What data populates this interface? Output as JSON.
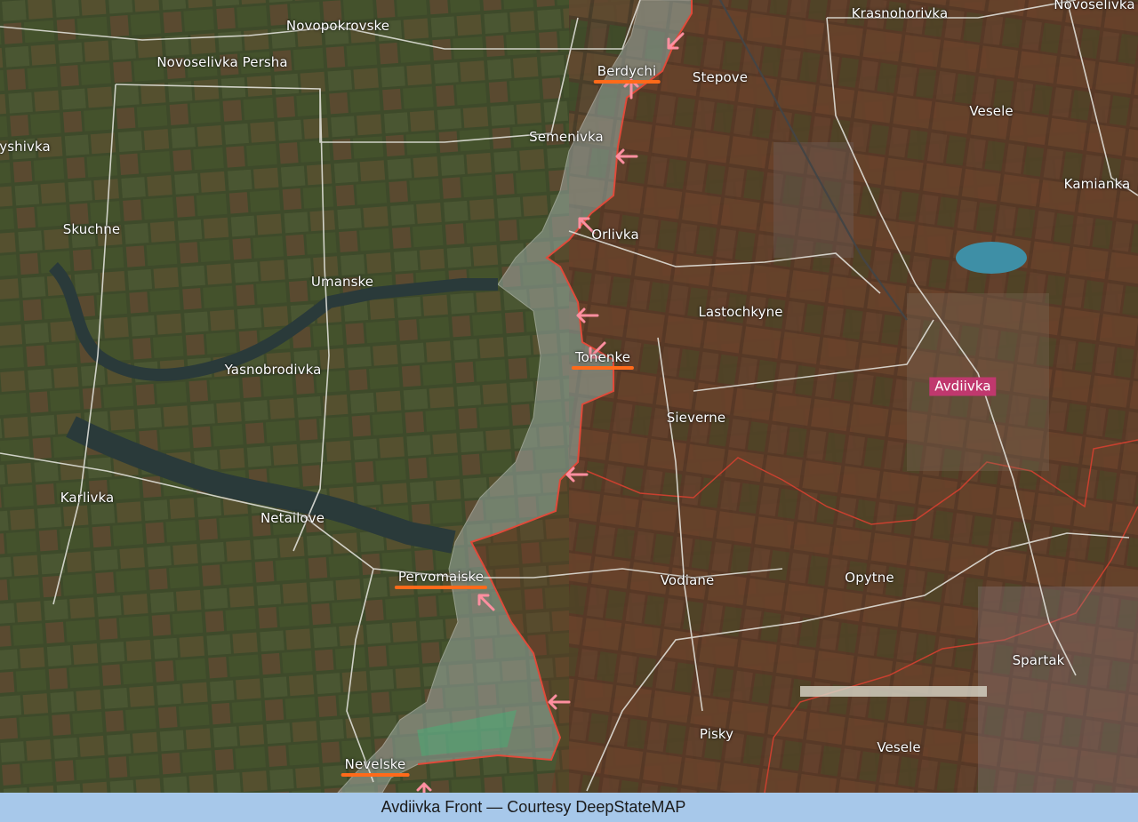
{
  "map": {
    "labels": [
      {
        "id": "novopokrovske",
        "text": "Novopokrovske"
      },
      {
        "id": "novoselivka-persha",
        "text": "Novoselivka Persha"
      },
      {
        "id": "berdychi",
        "text": "Berdychi"
      },
      {
        "id": "stepove",
        "text": "Stepove"
      },
      {
        "id": "krasnohorivka",
        "text": "Krasnohorivka"
      },
      {
        "id": "novoselivka",
        "text": "Novoselivka"
      },
      {
        "id": "vesele-north",
        "text": "Vesele"
      },
      {
        "id": "yshivka",
        "text": "yshivka"
      },
      {
        "id": "semenivka",
        "text": "Semenivka"
      },
      {
        "id": "kamianka",
        "text": "Kamianka"
      },
      {
        "id": "skuchne",
        "text": "Skuchne"
      },
      {
        "id": "orlivka",
        "text": "Orlivka"
      },
      {
        "id": "umanske",
        "text": "Umanske"
      },
      {
        "id": "lastochkyne",
        "text": "Lastochkyne"
      },
      {
        "id": "tonenke",
        "text": "Tonenke"
      },
      {
        "id": "yasnobrodivka",
        "text": "Yasnobrodivka"
      },
      {
        "id": "avdiivka",
        "text": "Avdiivka"
      },
      {
        "id": "sieverne",
        "text": "Sieverne"
      },
      {
        "id": "karlivka",
        "text": "Karlivka"
      },
      {
        "id": "netailove",
        "text": "Netailove"
      },
      {
        "id": "pervomaiske",
        "text": "Pervomaiske"
      },
      {
        "id": "vodiane",
        "text": "Vodiane"
      },
      {
        "id": "opytne",
        "text": "Opytne"
      },
      {
        "id": "spartak",
        "text": "Spartak"
      },
      {
        "id": "pisky",
        "text": "Pisky"
      },
      {
        "id": "vesele-south",
        "text": "Vesele"
      },
      {
        "id": "nevelske",
        "text": "Nevelske"
      }
    ],
    "underlined": [
      "berdychi",
      "tonenke",
      "pervomaiske",
      "nevelske"
    ],
    "highlighted_city": "avdiivka",
    "colors": {
      "front_line": "#e04a3a",
      "gray_zone": "#9aa8a2",
      "occupied_tint": "#7a2f22",
      "attack_arrow": "#ff8fa0",
      "highlight_underline": "#ff6a1a",
      "city_badge": "#c0386e",
      "roads": "#e8e8e2",
      "liberated_zone": "#35c27a"
    },
    "attack_arrow_icon": "arrow-icon"
  },
  "caption": "Avdiivka Front — Courtesy DeepStateMAP"
}
